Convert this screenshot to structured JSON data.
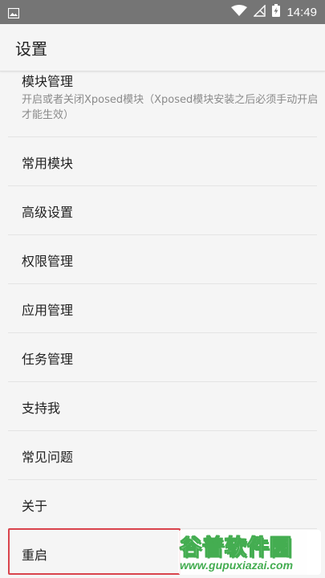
{
  "status_bar": {
    "time": "14:49",
    "icons": [
      "gallery-icon",
      "wifi-icon",
      "no-signal-icon",
      "battery-charging-icon"
    ]
  },
  "app_bar": {
    "title": "设置"
  },
  "settings": {
    "module_management": {
      "label": "模块管理",
      "description": "开启或者关闭Xposed模块（Xposed模块安装之后必须手动开启才能生效）"
    },
    "items": [
      {
        "label": "常用模块"
      },
      {
        "label": "高级设置"
      },
      {
        "label": "权限管理"
      },
      {
        "label": "应用管理"
      },
      {
        "label": "任务管理"
      },
      {
        "label": "支持我"
      },
      {
        "label": "常见问题"
      },
      {
        "label": "关于"
      },
      {
        "label": "重启"
      }
    ]
  },
  "watermark": {
    "title": "谷普软件园",
    "url": "www.gupuxiazai.com"
  },
  "colors": {
    "status_bar": "#757575",
    "highlight": "#d9434c",
    "watermark": "#37a845"
  }
}
